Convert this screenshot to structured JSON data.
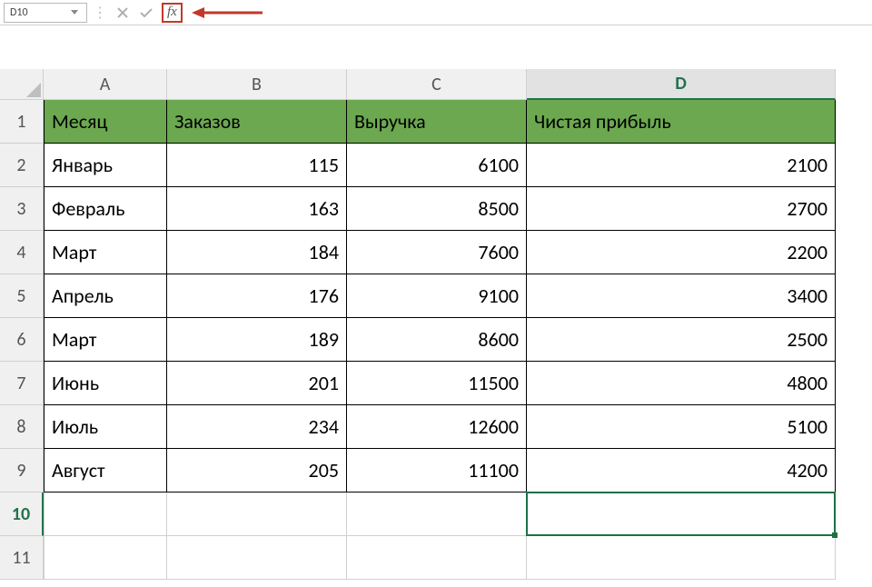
{
  "formula_bar": {
    "name_box_value": "D10",
    "fx_label": "fx"
  },
  "columns": [
    "A",
    "B",
    "C",
    "D"
  ],
  "row_numbers": [
    1,
    2,
    3,
    4,
    5,
    6,
    7,
    8,
    9,
    10,
    11
  ],
  "selected_cell": "D10",
  "table": {
    "headers": [
      "Месяц",
      "Заказов",
      "Выручка",
      "Чистая прибыль"
    ],
    "rows": [
      {
        "month": "Январь",
        "orders": 115,
        "revenue": 6100,
        "profit": 2100
      },
      {
        "month": "Февраль",
        "orders": 163,
        "revenue": 8500,
        "profit": 2700
      },
      {
        "month": "Март",
        "orders": 184,
        "revenue": 7600,
        "profit": 2200
      },
      {
        "month": "Апрель",
        "orders": 176,
        "revenue": 9100,
        "profit": 3400
      },
      {
        "month": "Март",
        "orders": 189,
        "revenue": 8600,
        "profit": 2500
      },
      {
        "month": "Июнь",
        "orders": 201,
        "revenue": 11500,
        "profit": 4800
      },
      {
        "month": "Июль",
        "orders": 234,
        "revenue": 12600,
        "profit": 5100
      },
      {
        "month": "Август",
        "orders": 205,
        "revenue": 11100,
        "profit": 4200
      }
    ]
  },
  "colors": {
    "header_fill": "#6ba84f",
    "selection": "#1d7044",
    "annotation": "#c0392b"
  }
}
